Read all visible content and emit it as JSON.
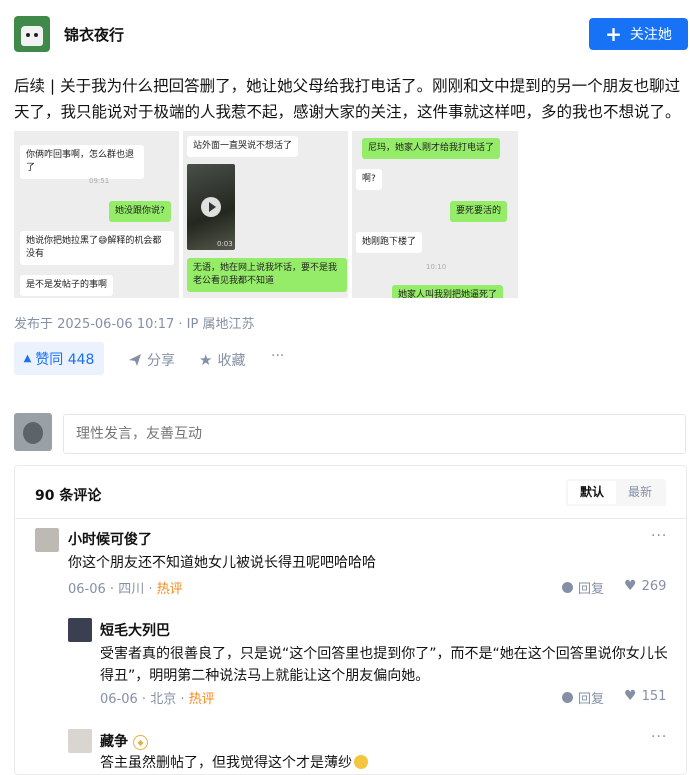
{
  "header": {
    "author_name": "锦衣夜行",
    "follow_label": "关注她",
    "follow_icon": "plus-icon"
  },
  "answer": {
    "text": "后续 | 关于我为什么把回答删了，她让她父母给我打电话了。刚刚和文中提到的另一个朋友也聊过天了，我只能说对于极端的人我惹不起，感谢大家的关注，这件事就这样吧，多的我也不想说了。",
    "meta": "发布于 2025-06-06 10:17 · IP 属地江苏"
  },
  "screenshots": {
    "shot1": {
      "b1": "你俩咋回事啊，怎么群也退了",
      "time": "09:51",
      "b2": "她没跟你说?",
      "b3": "她说你把她拉黑了😅解释的机会都没有",
      "b4": "是不是发帖子的事啊"
    },
    "shot2": {
      "b1": "站外面一直哭说不想活了",
      "video_duration": "0:03",
      "b2": "无语，她在网上说我坏话，要不是我老公看见我都不知道"
    },
    "shot3": {
      "b1": "尼玛，她家人刚才给我打电话了",
      "b2": "啊?",
      "b3": "要死要活的",
      "b4": "她刚跑下楼了",
      "time": "10:10",
      "b5": "她家人叫我别把她逼死了"
    }
  },
  "actions": {
    "vote_label": "赞同 448",
    "share_label": "分享",
    "collect_label": "收藏",
    "more_label": "···"
  },
  "comment_input": {
    "placeholder": "理性发言，友善互动"
  },
  "comments": {
    "count_label": "90 条评论",
    "sort_default": "默认",
    "sort_latest": "最新",
    "items": [
      {
        "name": "小时候可俊了",
        "text": "你这个朋友还不知道她女儿被说长得丑呢吧哈哈哈",
        "date": "06-06",
        "location": "四川",
        "tag": "热评",
        "reply": "回复",
        "likes": "269"
      },
      {
        "name": "短毛大列巴",
        "text": "受害者真的很善良了，只是说“这个回答里也提到你了”，而不是“她在这个回答里说你女儿长得丑”，明明第二种说法马上就能让这个朋友偏向她。",
        "date": "06-06",
        "location": "北京",
        "tag": "热评",
        "reply": "回复",
        "likes": "151"
      },
      {
        "name": "藏争",
        "text": "答主虽然删帖了，但我觉得这个才是薄纱",
        "more": "···"
      }
    ]
  },
  "colors": {
    "brand_blue": "#1772f6",
    "muted": "#8590a6",
    "hot": "#fa8919",
    "wechat_green": "#95ec69"
  }
}
